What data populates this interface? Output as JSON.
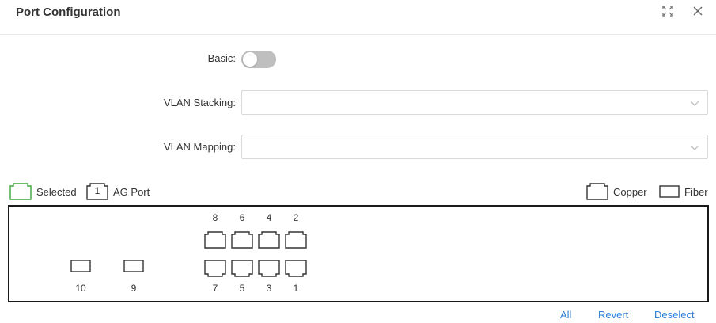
{
  "dialog": {
    "title": "Port Configuration",
    "icons": [
      "fullscreen-icon",
      "close-icon"
    ]
  },
  "form": {
    "basic_label": "Basic:",
    "basic_enabled": false,
    "vlan_stacking_label": "VLAN Stacking:",
    "vlan_stacking_value": "",
    "vlan_mapping_label": "VLAN Mapping:",
    "vlan_mapping_value": ""
  },
  "legend": {
    "selected_label": "Selected",
    "selected_color": "#3aa63a",
    "ag_port_badge": "1",
    "ag_port_label": "AG Port",
    "copper_label": "Copper",
    "fiber_label": "Fiber"
  },
  "ports": {
    "top_row": [
      "8",
      "6",
      "4",
      "2"
    ],
    "bottom_row": [
      "7",
      "5",
      "3",
      "1"
    ],
    "fiber": [
      "10",
      "9"
    ]
  },
  "actions": {
    "all": "All",
    "revert": "Revert",
    "deselect": "Deselect"
  },
  "colors": {
    "link": "#2f7fd8",
    "toggle_off": "#bfbfbf",
    "panel_border": "#1a1a1a"
  }
}
